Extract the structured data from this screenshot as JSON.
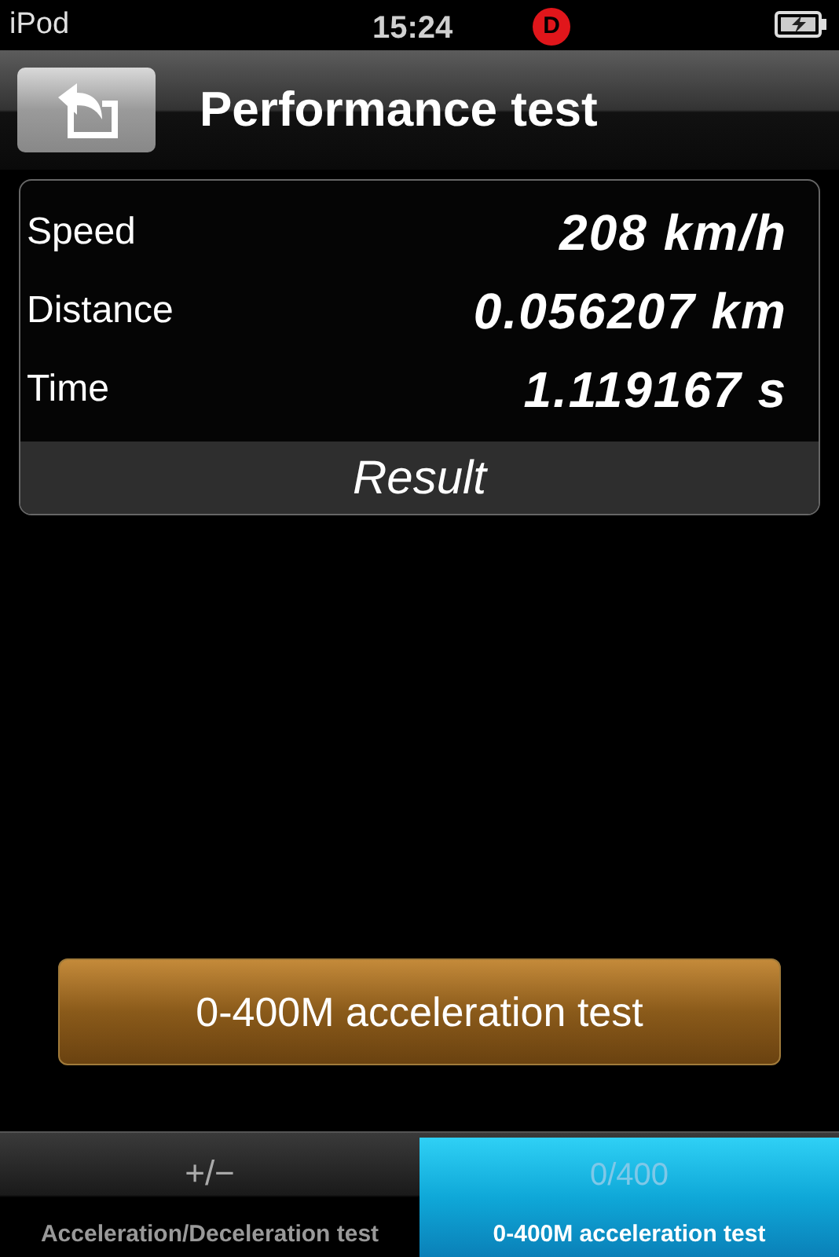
{
  "status_bar": {
    "carrier": "iPod",
    "time": "15:24",
    "badge": "D"
  },
  "nav_bar": {
    "title": "Performance test"
  },
  "results": {
    "rows": [
      {
        "label": "Speed",
        "value": "208 km/h"
      },
      {
        "label": "Distance",
        "value": "0.056207 km"
      },
      {
        "label": "Time",
        "value": "1.119167 s"
      }
    ],
    "footer": "Result"
  },
  "action_button": {
    "label": "0-400M acceleration test"
  },
  "tabs": [
    {
      "glyph": "+/−",
      "label": "Acceleration/Deceleration test",
      "selected": false
    },
    {
      "glyph": "0/400",
      "label": "0-400M acceleration test",
      "selected": true
    }
  ]
}
